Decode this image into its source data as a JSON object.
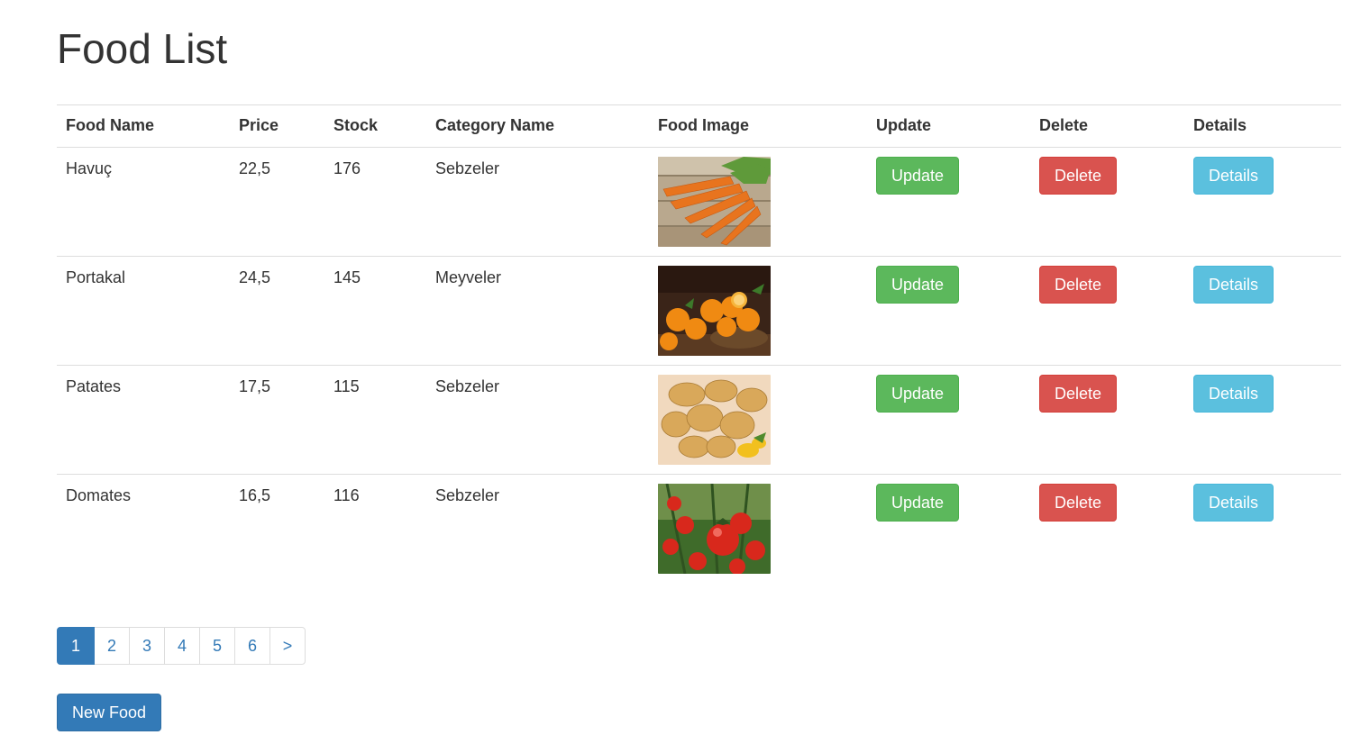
{
  "page": {
    "title": "Food List"
  },
  "table": {
    "headers": [
      "Food Name",
      "Price",
      "Stock",
      "Category Name",
      "Food Image",
      "Update",
      "Delete",
      "Details"
    ],
    "rows": [
      {
        "name": "Havuç",
        "price": "22,5",
        "stock": "176",
        "category": "Sebzeler",
        "image_icon": "carrot-photo",
        "update_label": "Update",
        "delete_label": "Delete",
        "details_label": "Details"
      },
      {
        "name": "Portakal",
        "price": "24,5",
        "stock": "145",
        "category": "Meyveler",
        "image_icon": "orange-photo",
        "update_label": "Update",
        "delete_label": "Delete",
        "details_label": "Details"
      },
      {
        "name": "Patates",
        "price": "17,5",
        "stock": "115",
        "category": "Sebzeler",
        "image_icon": "potato-photo",
        "update_label": "Update",
        "delete_label": "Delete",
        "details_label": "Details"
      },
      {
        "name": "Domates",
        "price": "16,5",
        "stock": "116",
        "category": "Sebzeler",
        "image_icon": "tomato-photo",
        "update_label": "Update",
        "delete_label": "Delete",
        "details_label": "Details"
      }
    ]
  },
  "pagination": {
    "pages": [
      "1",
      "2",
      "3",
      "4",
      "5",
      "6"
    ],
    "current": "1",
    "next_label": ">"
  },
  "actions": {
    "new_food_label": "New Food"
  },
  "colors": {
    "update": "#5cb85c",
    "delete": "#d9534f",
    "details": "#5bc0de",
    "primary": "#337ab7"
  }
}
